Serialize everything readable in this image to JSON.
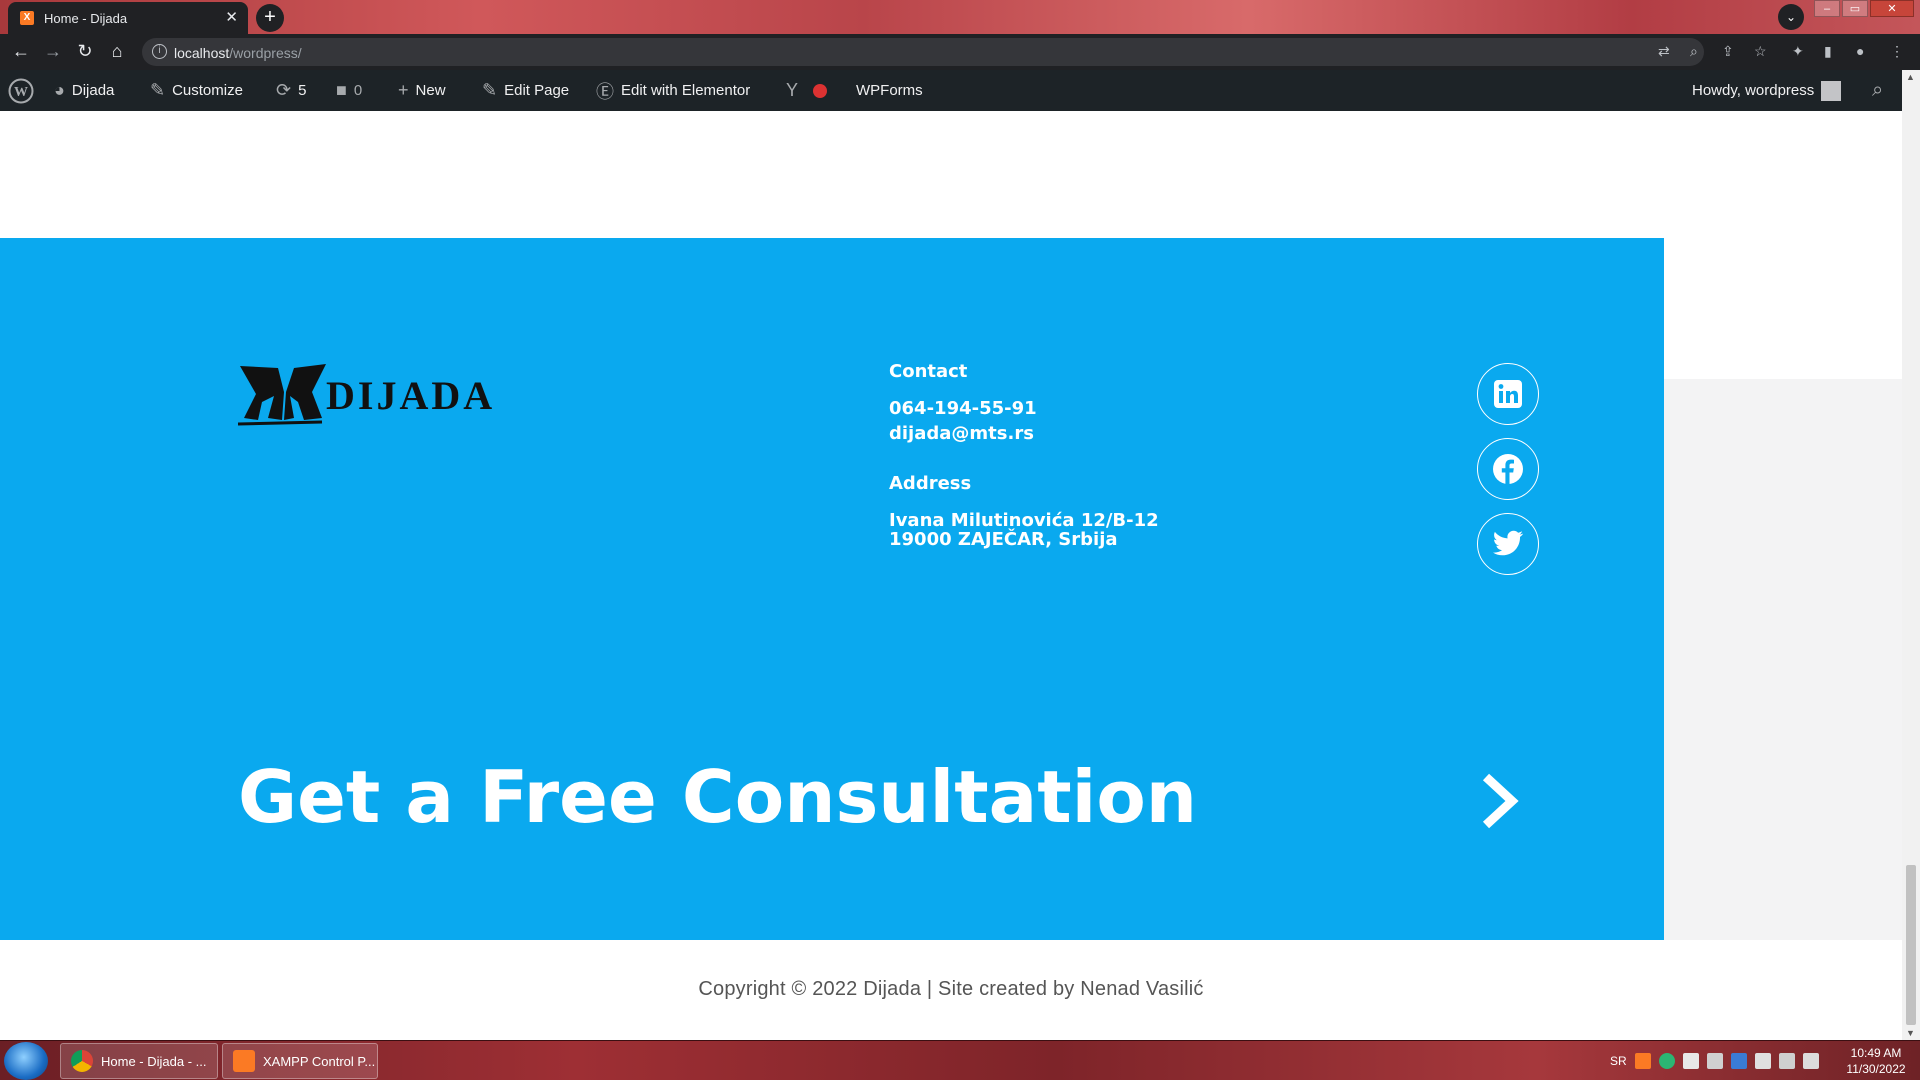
{
  "browser": {
    "tab_title": "Home - Dijada",
    "favicon_label": "X",
    "new_tab_label": "+",
    "url_host": "localhost",
    "url_path": "/wordpress/"
  },
  "adminbar": {
    "site_name": "Dijada",
    "customize": "Customize",
    "updates_count": "5",
    "comments_count": "0",
    "new": "New",
    "edit_page": "Edit Page",
    "edit_elementor": "Edit with Elementor",
    "wpforms": "WPForms",
    "howdy": "Howdy, wordpress"
  },
  "footer": {
    "logo_text": "DIJADA",
    "contact_heading": "Contact",
    "phone": "064-194-55-91",
    "email": "dijada@mts.rs",
    "address_heading": "Address",
    "address_line1": "Ivana Milutinovića 12/B-12",
    "address_line2": "19000 ZAJEČAR, Srbija",
    "social": [
      "linkedin-icon",
      "facebook-icon",
      "twitter-icon"
    ],
    "cta_text": "Get a Free Consultation",
    "copyright": "Copyright © 2022 Dijada | Site created by Nenad Vasilić"
  },
  "taskbar": {
    "items": [
      {
        "label": "Home - Dijada - ...",
        "icon": "chrome-icon"
      },
      {
        "label": "XAMPP Control P...",
        "icon": "xampp-icon"
      }
    ],
    "language": "SR",
    "time": "10:49 AM",
    "date": "11/30/2022"
  },
  "colors": {
    "footer_blue": "#0aa9ef",
    "admin_bar": "#1d2327",
    "browser_dark": "#202124"
  }
}
